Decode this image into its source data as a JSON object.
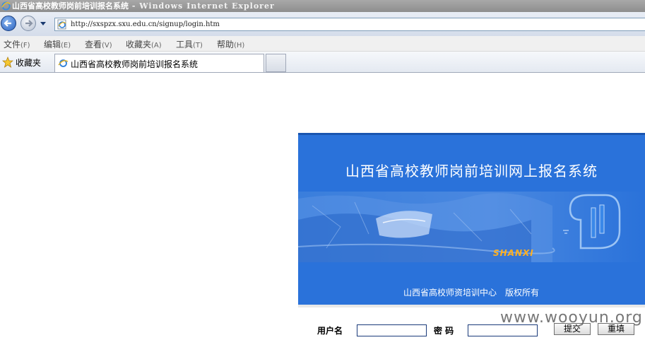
{
  "window": {
    "title": "山西省高校教师岗前培训报名系统",
    "app": " - Windows Internet Explorer"
  },
  "address_bar": {
    "url": "http://sxspzx.sxu.edu.cn/signup/login.htm"
  },
  "menu": [
    {
      "label": "文件",
      "accel": "(F)"
    },
    {
      "label": "编辑",
      "accel": "(E)"
    },
    {
      "label": "查看",
      "accel": "(V)"
    },
    {
      "label": "收藏夹",
      "accel": "(A)"
    },
    {
      "label": "工具",
      "accel": "(T)"
    },
    {
      "label": "帮助",
      "accel": "(H)"
    }
  ],
  "favorites": {
    "label": "收藏夹",
    "tab_label": "山西省高校教师岗前培训报名系统"
  },
  "banner": {
    "title": "山西省高校教师岗前培训网上报名系统",
    "tag": "SHANXI",
    "copyright": "山西省高校师资培训中心　版权所有"
  },
  "login": {
    "username_label": "用户名",
    "password_label": "密 码",
    "submit_label": "提交",
    "reset_label": "重填"
  },
  "watermark": "www.wooyun.org",
  "colors": {
    "banner_bg": "#2a72da",
    "title_text": "#ffffff",
    "accent_orange": "#ffb020"
  }
}
